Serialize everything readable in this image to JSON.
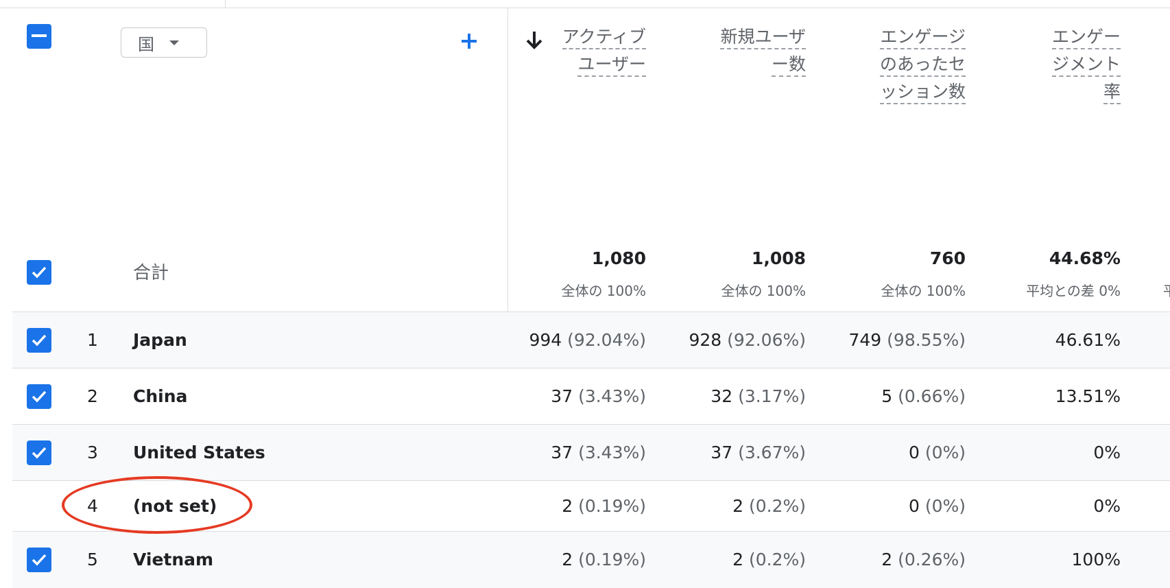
{
  "dimension": {
    "label": "国"
  },
  "headers": [
    {
      "lines": [
        "アクティブ",
        "ユーザー"
      ],
      "sorted": true
    },
    {
      "lines": [
        "新規ユーザ",
        "ー数"
      ],
      "sorted": false
    },
    {
      "lines": [
        "エンゲージ",
        "のあったセ",
        "ッション数"
      ],
      "sorted": false
    },
    {
      "lines": [
        "エンゲー",
        "ジメント",
        "率"
      ],
      "sorted": false
    }
  ],
  "totals": {
    "label": "合計",
    "values": [
      "1,080",
      "1,008",
      "760",
      "44.68%"
    ],
    "subs": [
      "全体の 100%",
      "全体の 100%",
      "全体の 100%",
      "平均との差 0%"
    ],
    "edge_glyph": "平"
  },
  "rows": [
    {
      "num": "1",
      "name": "Japan",
      "checked": true,
      "cells": [
        {
          "v": "994",
          "p": "(92.04%)"
        },
        {
          "v": "928",
          "p": "(92.06%)"
        },
        {
          "v": "749",
          "p": "(98.55%)"
        },
        {
          "v": "46.61%",
          "p": ""
        }
      ]
    },
    {
      "num": "2",
      "name": "China",
      "checked": true,
      "cells": [
        {
          "v": "37",
          "p": "(3.43%)"
        },
        {
          "v": "32",
          "p": "(3.17%)"
        },
        {
          "v": "5",
          "p": "(0.66%)"
        },
        {
          "v": "13.51%",
          "p": ""
        }
      ]
    },
    {
      "num": "3",
      "name": "United States",
      "checked": true,
      "cells": [
        {
          "v": "37",
          "p": "(3.43%)"
        },
        {
          "v": "37",
          "p": "(3.67%)"
        },
        {
          "v": "0",
          "p": "(0%)"
        },
        {
          "v": "0%",
          "p": ""
        }
      ]
    },
    {
      "num": "4",
      "name": "(not set)",
      "checked": false,
      "cells": [
        {
          "v": "2",
          "p": "(0.19%)"
        },
        {
          "v": "2",
          "p": "(0.2%)"
        },
        {
          "v": "0",
          "p": "(0%)"
        },
        {
          "v": "0%",
          "p": ""
        }
      ]
    },
    {
      "num": "5",
      "name": "Vietnam",
      "checked": true,
      "cells": [
        {
          "v": "2",
          "p": "(0.19%)"
        },
        {
          "v": "2",
          "p": "(0.2%)"
        },
        {
          "v": "2",
          "p": "(0.26%)"
        },
        {
          "v": "100%",
          "p": ""
        }
      ]
    }
  ],
  "colors": {
    "accent": "#1a73e8",
    "annotation": "#e53a23",
    "row_shade": "#f8f9fa"
  },
  "icons": {
    "add": "plus-icon",
    "sort": "arrow-down-icon",
    "dropdown": "caret-down-icon",
    "select_all": "minus-checkbox-icon"
  }
}
